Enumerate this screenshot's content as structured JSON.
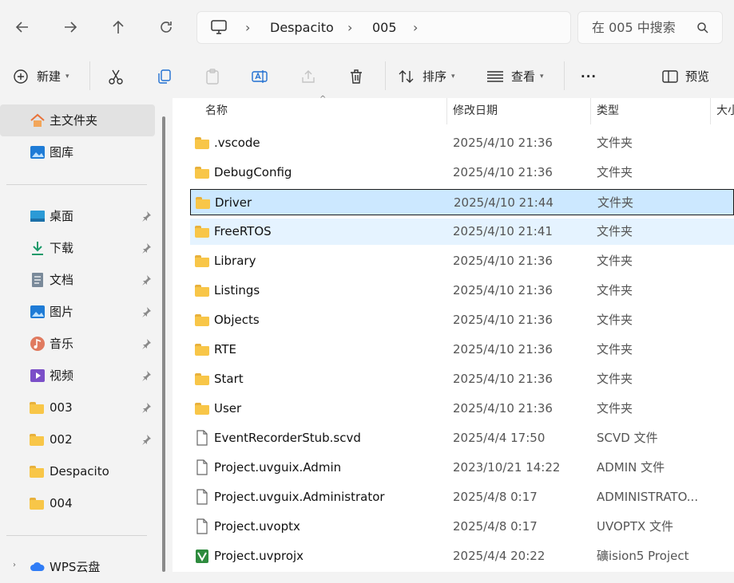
{
  "nav": {
    "back": "back",
    "forward": "forward",
    "up": "up",
    "refresh": "refresh"
  },
  "breadcrumb": {
    "items": [
      "Despacito",
      "005"
    ]
  },
  "search": {
    "placeholder": "在 005 中搜索"
  },
  "toolbar": {
    "new_label": "新建",
    "sort_label": "排序",
    "view_label": "查看",
    "more_label": "···",
    "preview_label": "预览"
  },
  "sidebar": {
    "top": [
      {
        "label": "主文件夹",
        "icon": "home-icon"
      },
      {
        "label": "图库",
        "icon": "gallery-icon"
      }
    ],
    "quick": [
      {
        "label": "桌面",
        "icon": "desktop-icon",
        "pinned": true
      },
      {
        "label": "下载",
        "icon": "download-icon",
        "pinned": true
      },
      {
        "label": "文档",
        "icon": "document-icon",
        "pinned": true
      },
      {
        "label": "图片",
        "icon": "pictures-icon",
        "pinned": true
      },
      {
        "label": "音乐",
        "icon": "music-icon",
        "pinned": true
      },
      {
        "label": "视频",
        "icon": "video-icon",
        "pinned": true
      },
      {
        "label": "003",
        "icon": "folder-icon",
        "pinned": true
      },
      {
        "label": "002",
        "icon": "folder-icon",
        "pinned": true
      },
      {
        "label": "Despacito",
        "icon": "folder-icon",
        "pinned": false
      },
      {
        "label": "004",
        "icon": "folder-icon",
        "pinned": false
      }
    ],
    "cloud": [
      {
        "label": "WPS云盘",
        "icon": "cloud-icon"
      }
    ]
  },
  "columns": {
    "name": "名称",
    "date": "修改日期",
    "type": "类型",
    "size": "大小"
  },
  "files": [
    {
      "name": ".vscode",
      "date": "2025/4/10 21:36",
      "type": "文件夹",
      "kind": "folder"
    },
    {
      "name": "DebugConfig",
      "date": "2025/4/10 21:36",
      "type": "文件夹",
      "kind": "folder"
    },
    {
      "name": "Driver",
      "date": "2025/4/10 21:44",
      "type": "文件夹",
      "kind": "folder",
      "state": "selected"
    },
    {
      "name": "FreeRTOS",
      "date": "2025/4/10 21:41",
      "type": "文件夹",
      "kind": "folder",
      "state": "hover"
    },
    {
      "name": "Library",
      "date": "2025/4/10 21:36",
      "type": "文件夹",
      "kind": "folder"
    },
    {
      "name": "Listings",
      "date": "2025/4/10 21:36",
      "type": "文件夹",
      "kind": "folder"
    },
    {
      "name": "Objects",
      "date": "2025/4/10 21:36",
      "type": "文件夹",
      "kind": "folder"
    },
    {
      "name": "RTE",
      "date": "2025/4/10 21:36",
      "type": "文件夹",
      "kind": "folder"
    },
    {
      "name": "Start",
      "date": "2025/4/10 21:36",
      "type": "文件夹",
      "kind": "folder"
    },
    {
      "name": "User",
      "date": "2025/4/10 21:36",
      "type": "文件夹",
      "kind": "folder"
    },
    {
      "name": "EventRecorderStub.scvd",
      "date": "2025/4/4 17:50",
      "type": "SCVD 文件",
      "kind": "file"
    },
    {
      "name": "Project.uvguix.Admin",
      "date": "2023/10/21 14:22",
      "type": "ADMIN 文件",
      "kind": "file"
    },
    {
      "name": "Project.uvguix.Administrator",
      "date": "2025/4/8 0:17",
      "type": "ADMINISTRATO...",
      "kind": "file"
    },
    {
      "name": "Project.uvoptx",
      "date": "2025/4/8 0:17",
      "type": "UVOPTX 文件",
      "kind": "file"
    },
    {
      "name": "Project.uvprojx",
      "date": "2025/4/4 20:22",
      "type": "礦ision5 Project",
      "kind": "uvproj"
    }
  ]
}
